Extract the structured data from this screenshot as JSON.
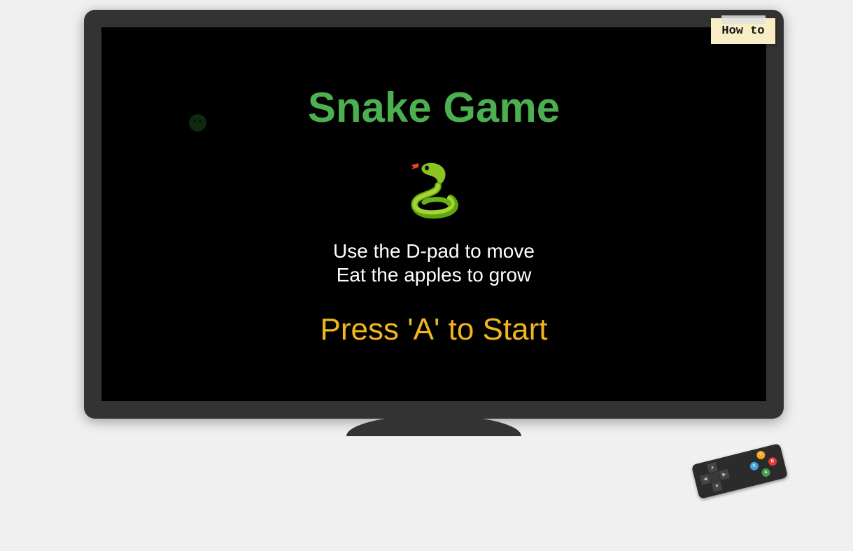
{
  "game": {
    "title": "Snake Game",
    "snake_emoji": "snake-icon",
    "instructions": [
      "Use the D-pad to move",
      "Eat the apples to grow"
    ],
    "start_prompt": "Press 'A' to Start"
  },
  "howto": {
    "label": "How to"
  },
  "controller": {
    "dpad": {
      "up": "▲",
      "down": "▼",
      "left": "◀",
      "right": "▶"
    },
    "buttons": [
      {
        "label": "Y",
        "color": "#f5a623"
      },
      {
        "label": "X",
        "color": "#3aa3d8"
      },
      {
        "label": "B",
        "color": "#e53935"
      },
      {
        "label": "A",
        "color": "#43a047"
      }
    ]
  },
  "colors": {
    "title": "#4caf50",
    "start_prompt": "#f2b61b",
    "tv_frame": "#333333",
    "screen": "#000000",
    "background": "#f0f0f0"
  }
}
